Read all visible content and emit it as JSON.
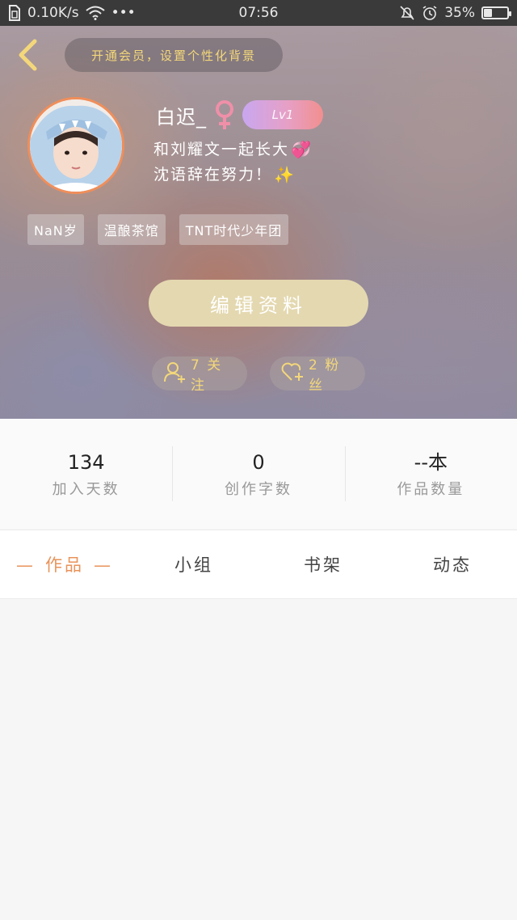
{
  "status_bar": {
    "speed": "0.10K/s",
    "more": "•••",
    "time": "07:56",
    "battery": "35%",
    "battery_level": 0.35
  },
  "header": {
    "vip_banner": "开通会员，设置个性化背景",
    "username": "白迟_",
    "level": "Lv1",
    "bio_line1": "和刘耀文一起长大",
    "bio_line1_emoji": "💞",
    "bio_line2": "沈语辞在努力！",
    "bio_line2_emoji": "✨",
    "tags": [
      "NaN岁",
      "温酿茶馆",
      "TNT时代少年团"
    ],
    "edit_button": "编辑资料",
    "follow_label": "7 关注",
    "fans_label": "2 粉丝"
  },
  "stats": [
    {
      "value": "134",
      "label": "加入天数"
    },
    {
      "value": "0",
      "label": "创作字数"
    },
    {
      "value": "--本",
      "label": "作品数量"
    }
  ],
  "tabs": {
    "works": "作品",
    "works_dash": "—",
    "group": "小组",
    "bookshelf": "书架",
    "activity": "动态"
  },
  "colors": {
    "accent": "#e8935a",
    "gold": "#f3d77a",
    "edit_button": "#e4d8b0",
    "avatar_border": "#f08e5a"
  },
  "icons": {
    "back": "chevron-left-icon",
    "gender": "female-icon",
    "follow": "add-user-icon",
    "fans": "heart-plus-icon",
    "wifi": "wifi-icon",
    "sim": "sim-icon",
    "mute": "bell-off-icon",
    "alarm": "alarm-icon"
  }
}
